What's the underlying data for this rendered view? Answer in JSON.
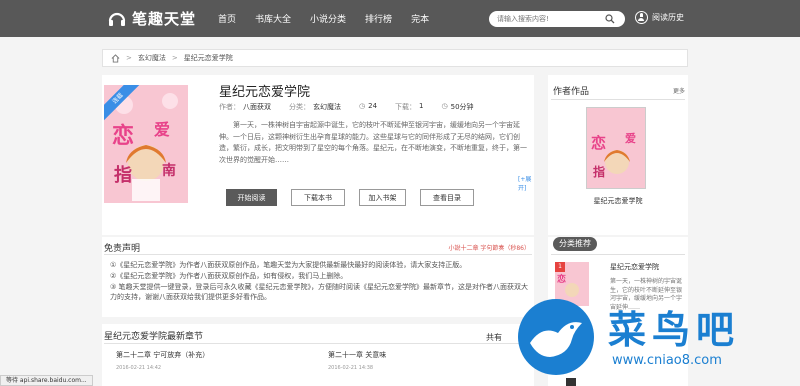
{
  "header": {
    "logo_text": "笔趣天堂",
    "nav": [
      "首页",
      "书库大全",
      "小说分类",
      "排行榜",
      "完本"
    ],
    "search_placeholder": "请输入搜索内容!",
    "history_label": "阅读历史"
  },
  "breadcrumb": {
    "items": [
      "玄幻魔法",
      "星纪元恋爱学院"
    ]
  },
  "book": {
    "cover_badge": "连载",
    "title": "星纪元恋爱学院",
    "author_label": "作者：",
    "author": "八面获双",
    "category_label": "分类：",
    "category": "玄幻魔法",
    "stat_a": "24",
    "stat_b_label": "下载：",
    "stat_b": "1",
    "stat_c": "50分钟",
    "description": "第一天，一株神树自宇宙起源中诞生，它的枝叶不断延伸至银河宇宙，缓缓地向另一个宇宙延伸。一个日后，这颗神树衍生出孕育星球的能力。这些星球与它的同伴形成了无尽的结网，它们创造，繁衍，成长，把文明带到了星空的每个角落。星纪元，在不断地演变，不断地重复，终于，第一次世界的觉醒开始……",
    "more_link": "[+展开]",
    "buttons": {
      "read": "开始阅读",
      "download": "下载本书",
      "shelf": "加入书架",
      "catalog": "查看目录"
    }
  },
  "author_works": {
    "heading": "作者作品",
    "more": "更多",
    "item_title": "星纪元恋爱学院"
  },
  "disclaimer": {
    "heading": "免责声明",
    "tag": "小說十二章 字句節奏（秒86）",
    "lines": [
      "①《星纪元恋爱学院》为作者八面获双原创作品，笔趣天堂为大家提供最新最快最好的阅读体验，请大家支持正版。",
      "②《星纪元恋爱学院》为作者八面获双原创作品，如有侵权，我们马上删除。",
      "③ 笔趣天堂提供一键登录，登录后可永久收藏《星纪元恋爱学院》，方便随时阅读《星纪元恋爱学院》最新章节，这是对作者八面获双大力的支持，谢谢八面获双给我们提供更多好看作品。"
    ]
  },
  "recommend": {
    "tab": "分类推荐",
    "rank": "1",
    "title": "星纪元恋爱学院",
    "desc": "第一天，一株神树的宇宙诞生，它的枝叶不断延伸至银河宇宙，缓缓地向另一个宇宙延伸……"
  },
  "latest": {
    "heading": "星纪元恋爱学院最新章节",
    "total_label": "共有",
    "chapters": [
      {
        "title": "第二十二章 宁可放弃（补充）",
        "date": "2016-02-21 14:42"
      },
      {
        "title": "第二十一章 关意味",
        "date": "2016-02-21 14:38"
      }
    ]
  },
  "status_bar": "等待 api.share.baidu.com...",
  "watermark": {
    "text": "菜鸟吧",
    "url": "www.cniao8.com"
  },
  "colors": {
    "topbar": "#585858",
    "accent_blue": "#1b7fd1",
    "primary_button": "#5a5a5a",
    "alert_red": "#d9534f"
  }
}
